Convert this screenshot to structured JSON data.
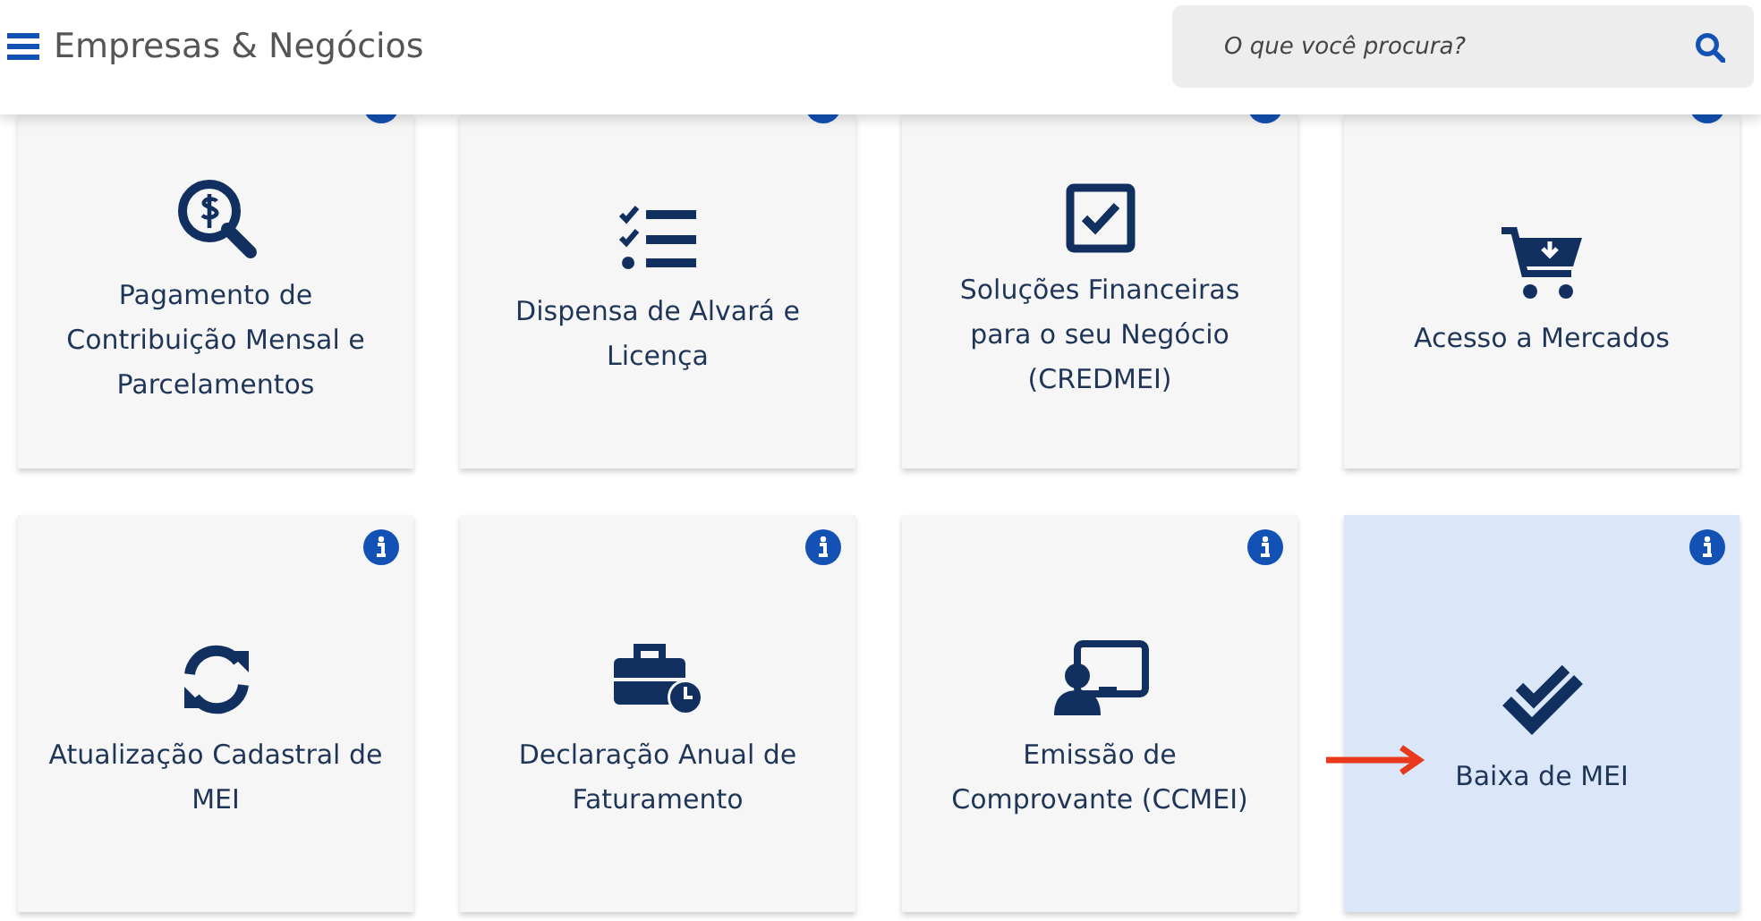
{
  "header": {
    "title": "Empresas & Negócios",
    "search": {
      "placeholder": "O que você procura?"
    }
  },
  "cards": [
    {
      "kind": "money-search",
      "label": "Pagamento de Contribuição Mensal e Parcelamentos",
      "selected": false,
      "arrow": false
    },
    {
      "kind": "checklist",
      "label": "Dispensa de Alvará e Licença",
      "selected": false,
      "arrow": false
    },
    {
      "kind": "checkbox",
      "label": "Soluções Financeiras para o seu Negócio (CREDMEI)",
      "selected": false,
      "arrow": false
    },
    {
      "kind": "cart",
      "label": "Acesso a Mercados",
      "selected": false,
      "arrow": false
    },
    {
      "kind": "refresh",
      "label": "Atualização Cadastral de MEI",
      "selected": false,
      "arrow": false
    },
    {
      "kind": "briefcase-clock",
      "label": "Declaração Anual de Faturamento",
      "selected": false,
      "arrow": false
    },
    {
      "kind": "presenter",
      "label": "Emissão de Comprovante (CCMEI)",
      "selected": false,
      "arrow": false
    },
    {
      "kind": "double-check",
      "label": "Baixa de MEI",
      "selected": true,
      "arrow": true
    }
  ]
}
